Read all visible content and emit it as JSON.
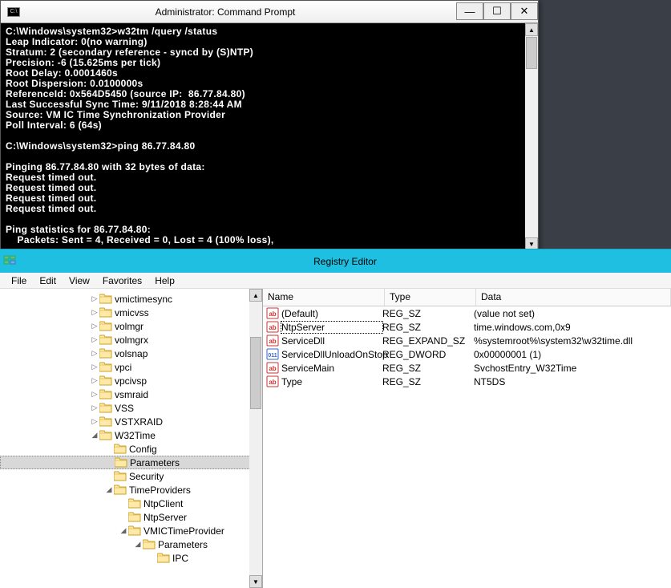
{
  "cmd": {
    "icon_text": "C:\\",
    "title": "Administrator: Command Prompt",
    "buttons": {
      "min": "—",
      "max": "☐",
      "close": "✕"
    },
    "output": "C:\\Windows\\system32>w32tm /query /status\nLeap Indicator: 0(no warning)\nStratum: 2 (secondary reference - syncd by (S)NTP)\nPrecision: -6 (15.625ms per tick)\nRoot Delay: 0.0001460s\nRoot Dispersion: 0.0100000s\nReferenceId: 0x564D5450 (source IP:  86.77.84.80)\nLast Successful Sync Time: 9/11/2018 8:28:44 AM\nSource: VM IC Time Synchronization Provider\nPoll Interval: 6 (64s)\n\nC:\\Windows\\system32>ping 86.77.84.80\n\nPinging 86.77.84.80 with 32 bytes of data:\nRequest timed out.\nRequest timed out.\nRequest timed out.\nRequest timed out.\n\nPing statistics for 86.77.84.80:\n    Packets: Sent = 4, Received = 0, Lost = 4 (100% loss),"
  },
  "regedit": {
    "title": "Registry Editor",
    "menus": [
      "File",
      "Edit",
      "View",
      "Favorites",
      "Help"
    ],
    "tree": [
      {
        "indent": 112,
        "exp": "▷",
        "label": "vmictimesync"
      },
      {
        "indent": 112,
        "exp": "▷",
        "label": "vmicvss"
      },
      {
        "indent": 112,
        "exp": "▷",
        "label": "volmgr"
      },
      {
        "indent": 112,
        "exp": "▷",
        "label": "volmgrx"
      },
      {
        "indent": 112,
        "exp": "▷",
        "label": "volsnap"
      },
      {
        "indent": 112,
        "exp": "▷",
        "label": "vpci"
      },
      {
        "indent": 112,
        "exp": "▷",
        "label": "vpcivsp"
      },
      {
        "indent": 112,
        "exp": "▷",
        "label": "vsmraid"
      },
      {
        "indent": 112,
        "exp": "▷",
        "label": "VSS"
      },
      {
        "indent": 112,
        "exp": "▷",
        "label": "VSTXRAID"
      },
      {
        "indent": 112,
        "exp": "◢",
        "label": "W32Time"
      },
      {
        "indent": 130,
        "exp": "",
        "label": "Config"
      },
      {
        "indent": 130,
        "exp": "",
        "label": "Parameters",
        "sel": true
      },
      {
        "indent": 130,
        "exp": "",
        "label": "Security"
      },
      {
        "indent": 130,
        "exp": "◢",
        "label": "TimeProviders"
      },
      {
        "indent": 148,
        "exp": "",
        "label": "NtpClient"
      },
      {
        "indent": 148,
        "exp": "",
        "label": "NtpServer"
      },
      {
        "indent": 148,
        "exp": "◢",
        "label": "VMICTimeProvider"
      },
      {
        "indent": 166,
        "exp": "◢",
        "label": "Parameters"
      },
      {
        "indent": 184,
        "exp": "",
        "label": "IPC"
      }
    ],
    "columns": {
      "name": "Name",
      "type": "Type",
      "data": "Data"
    },
    "values": [
      {
        "icon": "str",
        "name": "(Default)",
        "type": "REG_SZ",
        "data": "(value not set)"
      },
      {
        "icon": "str",
        "name": "NtpServer",
        "type": "REG_SZ",
        "data": "time.windows.com,0x9",
        "sel": true
      },
      {
        "icon": "str",
        "name": "ServiceDll",
        "type": "REG_EXPAND_SZ",
        "data": "%systemroot%\\system32\\w32time.dll"
      },
      {
        "icon": "bin",
        "name": "ServiceDllUnloadOnStop",
        "type": "REG_DWORD",
        "data": "0x00000001 (1)"
      },
      {
        "icon": "str",
        "name": "ServiceMain",
        "type": "REG_SZ",
        "data": "SvchostEntry_W32Time"
      },
      {
        "icon": "str",
        "name": "Type",
        "type": "REG_SZ",
        "data": "NT5DS"
      }
    ]
  }
}
